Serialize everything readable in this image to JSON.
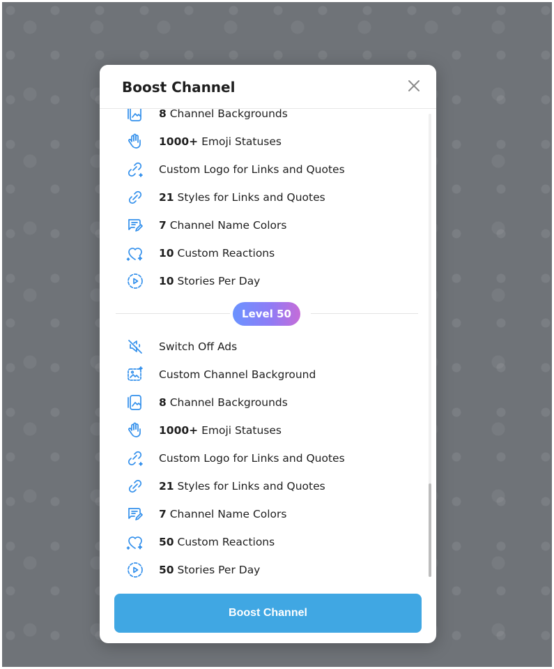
{
  "modal": {
    "title": "Boost Channel",
    "close_icon": "close-icon",
    "button_label": "Boost Channel"
  },
  "colors": {
    "accent": "#40a7e3",
    "icon": "#3390ec",
    "badge_gradient": [
      "#6b93ff",
      "#c56cd8"
    ]
  },
  "level_top": {
    "features": [
      {
        "icon": "wallpapers-icon",
        "bold": "8",
        "text": " Channel Backgrounds"
      },
      {
        "icon": "hand-wave-icon",
        "bold": "1000+",
        "text": " Emoji Statuses"
      },
      {
        "icon": "link-sparkle-icon",
        "bold": "",
        "text": "Custom Logo for Links and Quotes"
      },
      {
        "icon": "link-icon",
        "bold": "21",
        "text": " Styles for Links and Quotes"
      },
      {
        "icon": "name-colors-icon",
        "bold": "7",
        "text": " Channel Name Colors"
      },
      {
        "icon": "heart-sparkle-icon",
        "bold": "10",
        "text": " Custom Reactions"
      },
      {
        "icon": "stories-icon",
        "bold": "10",
        "text": " Stories Per Day"
      }
    ]
  },
  "level_badge": "Level 50",
  "level_bottom": {
    "features": [
      {
        "icon": "ads-off-icon",
        "bold": "",
        "text": "Switch Off Ads"
      },
      {
        "icon": "custom-background-icon",
        "bold": "",
        "text": "Custom Channel Background"
      },
      {
        "icon": "wallpapers-icon",
        "bold": "8",
        "text": " Channel Backgrounds"
      },
      {
        "icon": "hand-wave-icon",
        "bold": "1000+",
        "text": " Emoji Statuses"
      },
      {
        "icon": "link-sparkle-icon",
        "bold": "",
        "text": "Custom Logo for Links and Quotes"
      },
      {
        "icon": "link-icon",
        "bold": "21",
        "text": " Styles for Links and Quotes"
      },
      {
        "icon": "name-colors-icon",
        "bold": "7",
        "text": " Channel Name Colors"
      },
      {
        "icon": "heart-sparkle-icon",
        "bold": "50",
        "text": " Custom Reactions"
      },
      {
        "icon": "stories-icon",
        "bold": "50",
        "text": " Stories Per Day"
      }
    ]
  }
}
